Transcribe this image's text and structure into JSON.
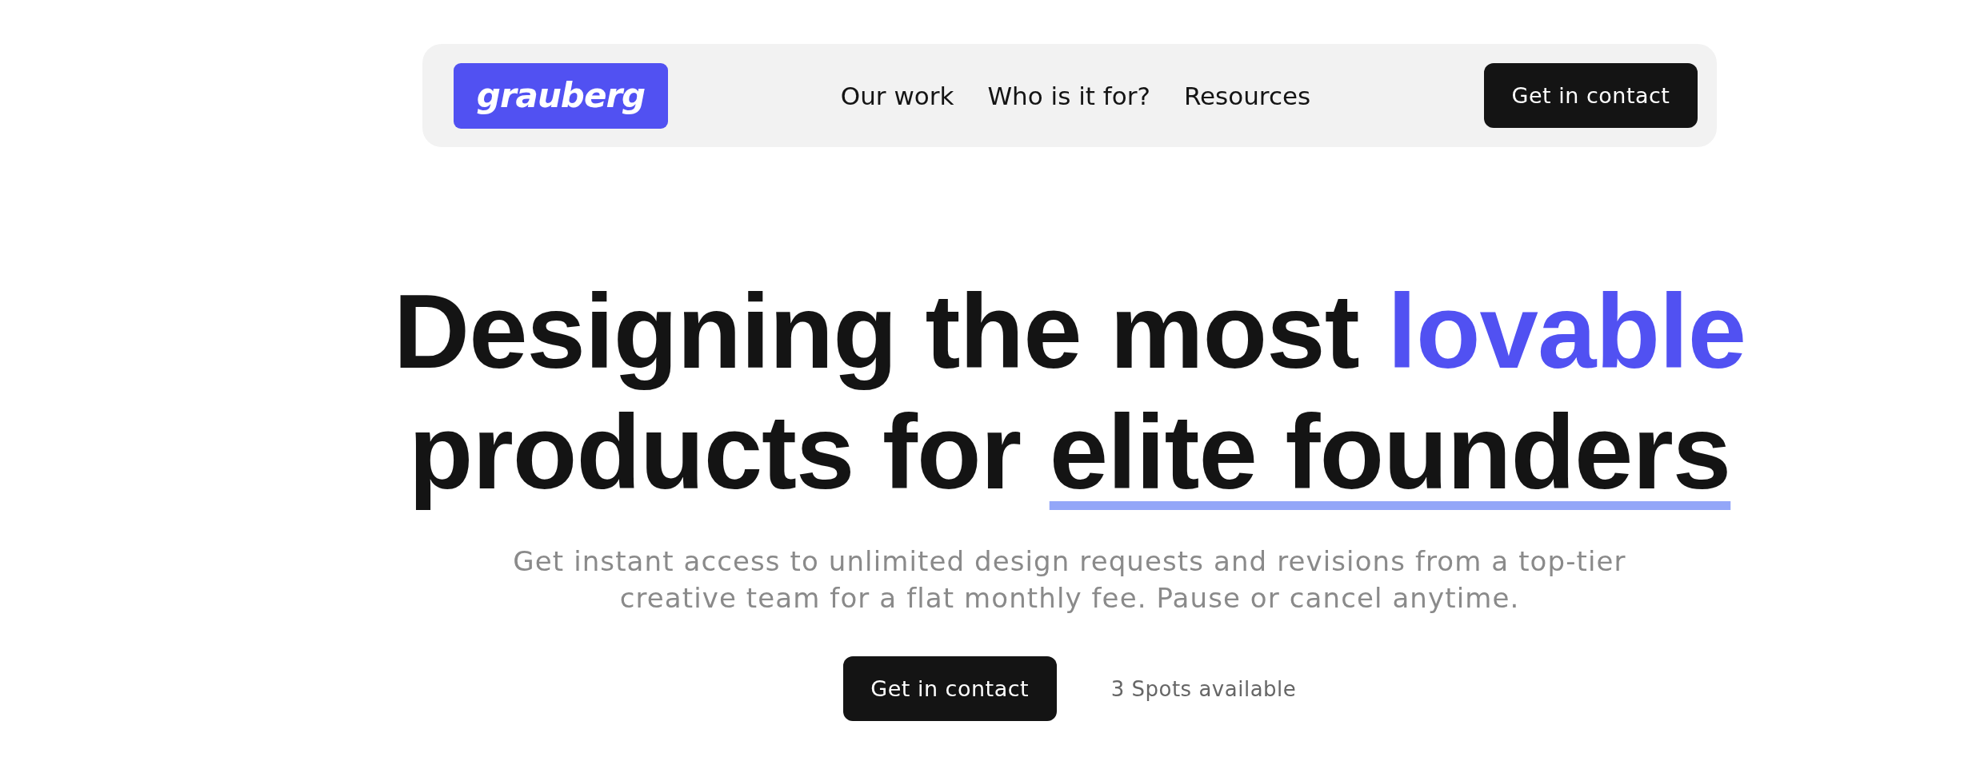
{
  "nav": {
    "logo": "grauberg",
    "links": [
      {
        "label": "Our work"
      },
      {
        "label": "Who is it for?"
      },
      {
        "label": "Resources"
      }
    ],
    "cta": "Get in contact"
  },
  "hero": {
    "headline_lines": [
      [
        {
          "text": "Designing the most",
          "kind": "plain"
        },
        {
          "text": "lovable",
          "kind": "accent"
        }
      ],
      [
        {
          "text": "products for",
          "kind": "plain"
        },
        {
          "text": "elite founders",
          "kind": "underlined"
        }
      ]
    ],
    "subtitle_lines": [
      "Get instant access to unlimited design requests and revisions from a top-tier",
      "creative team for a flat monthly fee. Pause or cancel anytime."
    ],
    "cta": "Get in contact",
    "availability": "3 Spots available"
  }
}
